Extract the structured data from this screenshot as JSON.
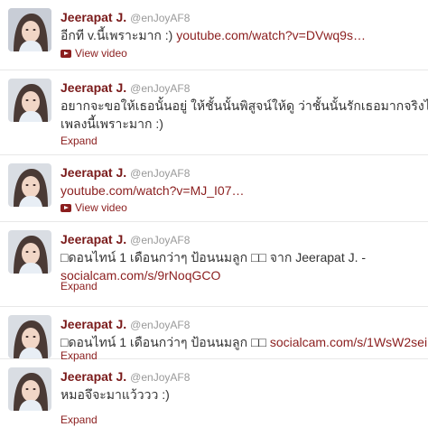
{
  "colors": {
    "name": "#7a1a1a",
    "link": "#8b1e1e",
    "handle": "#999999",
    "text": "#333333",
    "divider": "#e8e8e8"
  },
  "tweets": [
    {
      "name": "Jeerapat J.",
      "handle": "@enJoyAF8",
      "text": "อีกที v.นี้เพราะมาก :) ",
      "link": "youtube.com/watch?v=DVwq9s…",
      "action": "View video",
      "action_icon": "youtube-play-icon"
    },
    {
      "name": "Jeerapat J.",
      "handle": "@enJoyAF8",
      "line1": "อยากจะขอให้เธอนั้นอยู่ ให้ชั้นนั้นพิสูจน์ให้ดู ว่าชั้นนั้นรักเธอมากจริงไหม",
      "line2": "เพลงนี้เพราะมาก :)",
      "action": "Expand"
    },
    {
      "name": "Jeerapat J.",
      "handle": "@enJoyAF8",
      "link": "youtube.com/watch?v=MJ_I07…",
      "action": "View video",
      "action_icon": "youtube-play-icon"
    },
    {
      "name": "Jeerapat J.",
      "handle": "@enJoyAF8",
      "line1": "□ดอนไทน์ 1 เดือนกว่าๆ ป้อนนมลูก □□ จาก Jeerapat J. -",
      "link": "socialcam.com/s/9rNoqGCO",
      "action": "Expand"
    },
    {
      "name": "Jeerapat J.",
      "handle": "@enJoyAF8",
      "text": "□ดอนไทน์ 1 เดือนกว่าๆ ป้อนนมลูก □□ ",
      "link": "socialcam.com/s/1WsW2sei",
      "action": "Expand"
    },
    {
      "name": "Jeerapat J.",
      "handle": "@enJoyAF8",
      "text": "หมอจึจะมาแว้ววว :)",
      "action": "Expand"
    }
  ]
}
